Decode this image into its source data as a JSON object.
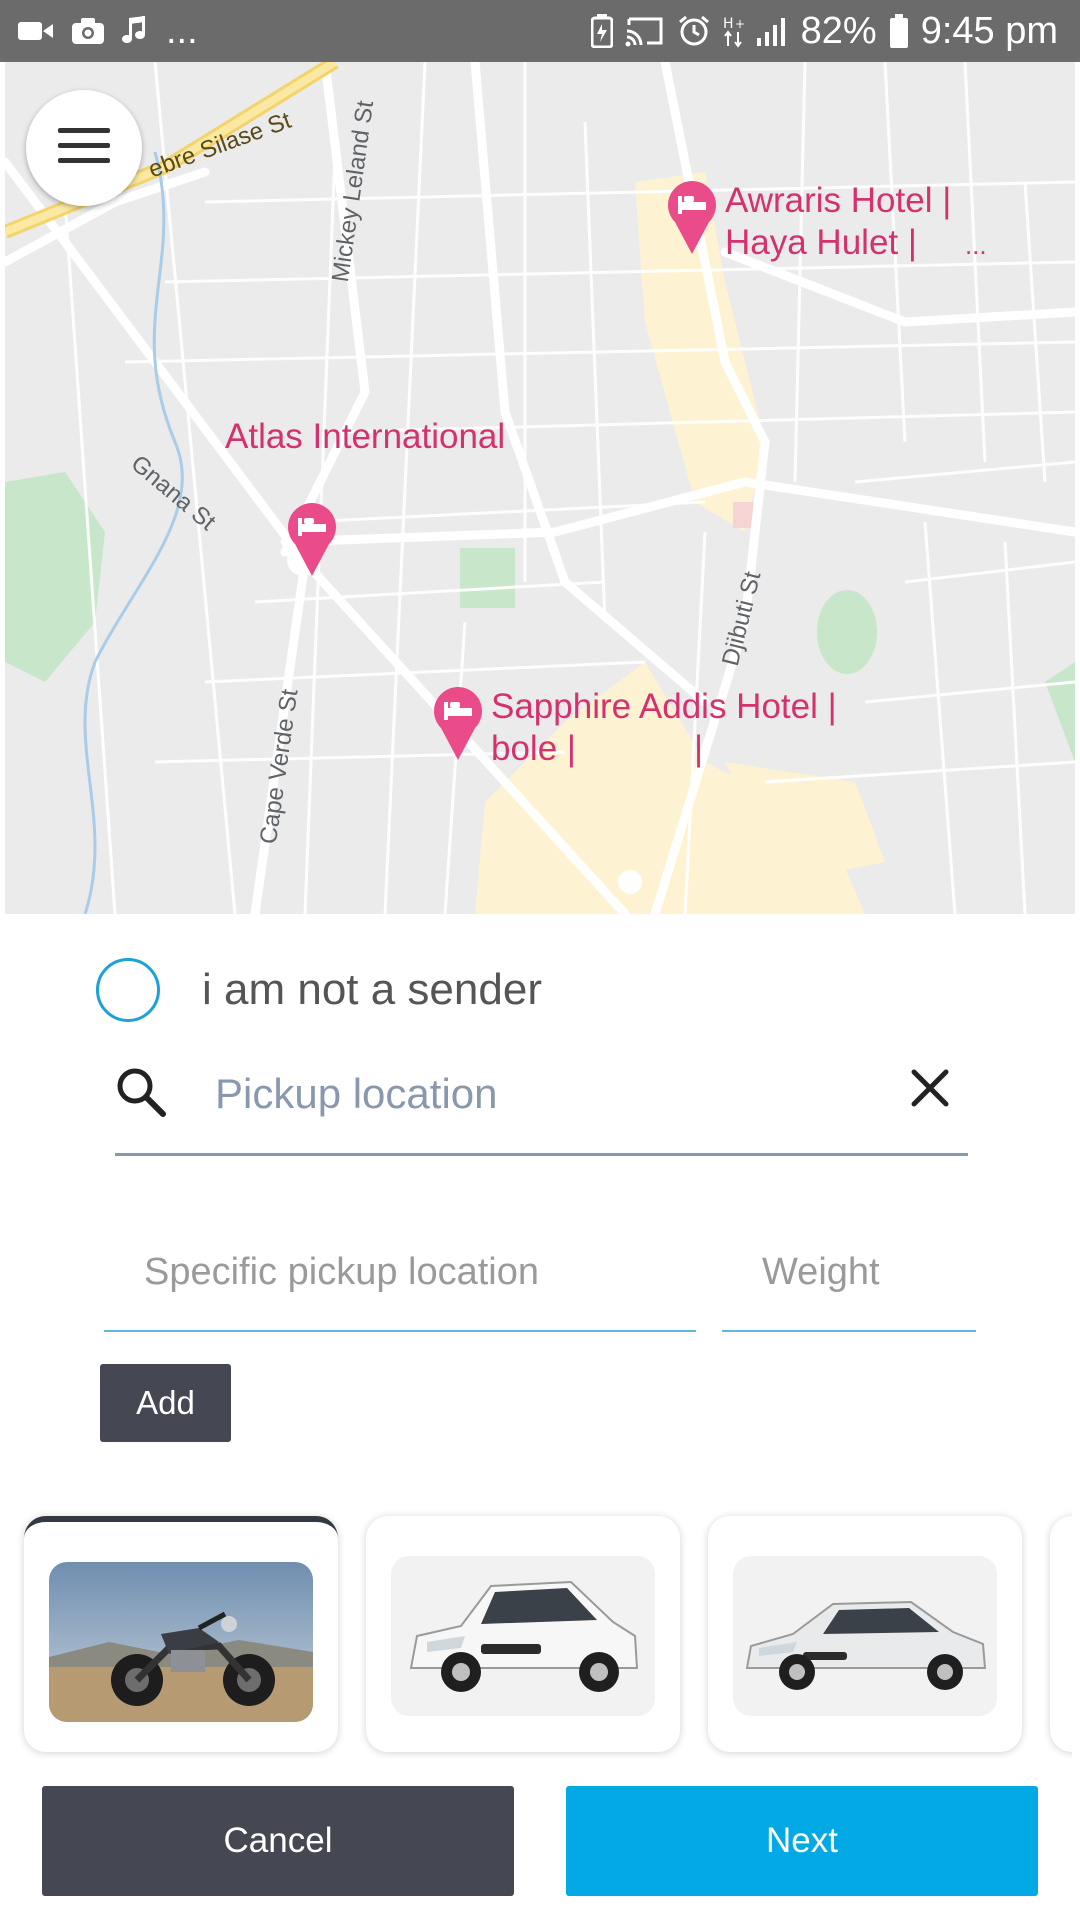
{
  "status_bar": {
    "left_dots": "...",
    "battery": "82%",
    "time": "9:45 pm",
    "icons": [
      "video-icon",
      "camera-icon",
      "music-icon",
      "battery-saver-icon",
      "cast-icon",
      "alarm-icon",
      "data-icon",
      "signal-icon",
      "battery-icon"
    ]
  },
  "map": {
    "streets": [
      "ebre Silase St",
      "Mickey Leland St",
      "Gnana St",
      "Cape Verde St",
      "Djibuti St"
    ],
    "pois": [
      {
        "line1": "Awraris Hotel |",
        "line2": "Haya Hulet |",
        "extra": "..."
      },
      {
        "line1": "Atlas International",
        "line2": "",
        "extra": ""
      },
      {
        "line1": "Sapphire Addis Hotel |",
        "line2": "bole |",
        "extra": "|"
      }
    ],
    "colors": {
      "background": "#ebebeb",
      "road": "#ffffff",
      "commercial": "#fdf3d3",
      "park": "#c8e6c9",
      "poi": "#d4326e"
    }
  },
  "menu_icon": "hamburger-menu-icon",
  "form": {
    "sender_label": "i am not a sender",
    "pickup_placeholder": "Pickup location",
    "pickup_value": "",
    "specific_placeholder": "Specific pickup location",
    "weight_placeholder": "Weight",
    "add_label": "Add"
  },
  "vehicles": [
    {
      "name": "motorcycle",
      "selected": true
    },
    {
      "name": "hatchback-car",
      "selected": false
    },
    {
      "name": "sedan-car",
      "selected": false
    }
  ],
  "actions": {
    "cancel_label": "Cancel",
    "next_label": "Next",
    "cancel_color": "#454852",
    "next_color": "#03a9e4"
  }
}
